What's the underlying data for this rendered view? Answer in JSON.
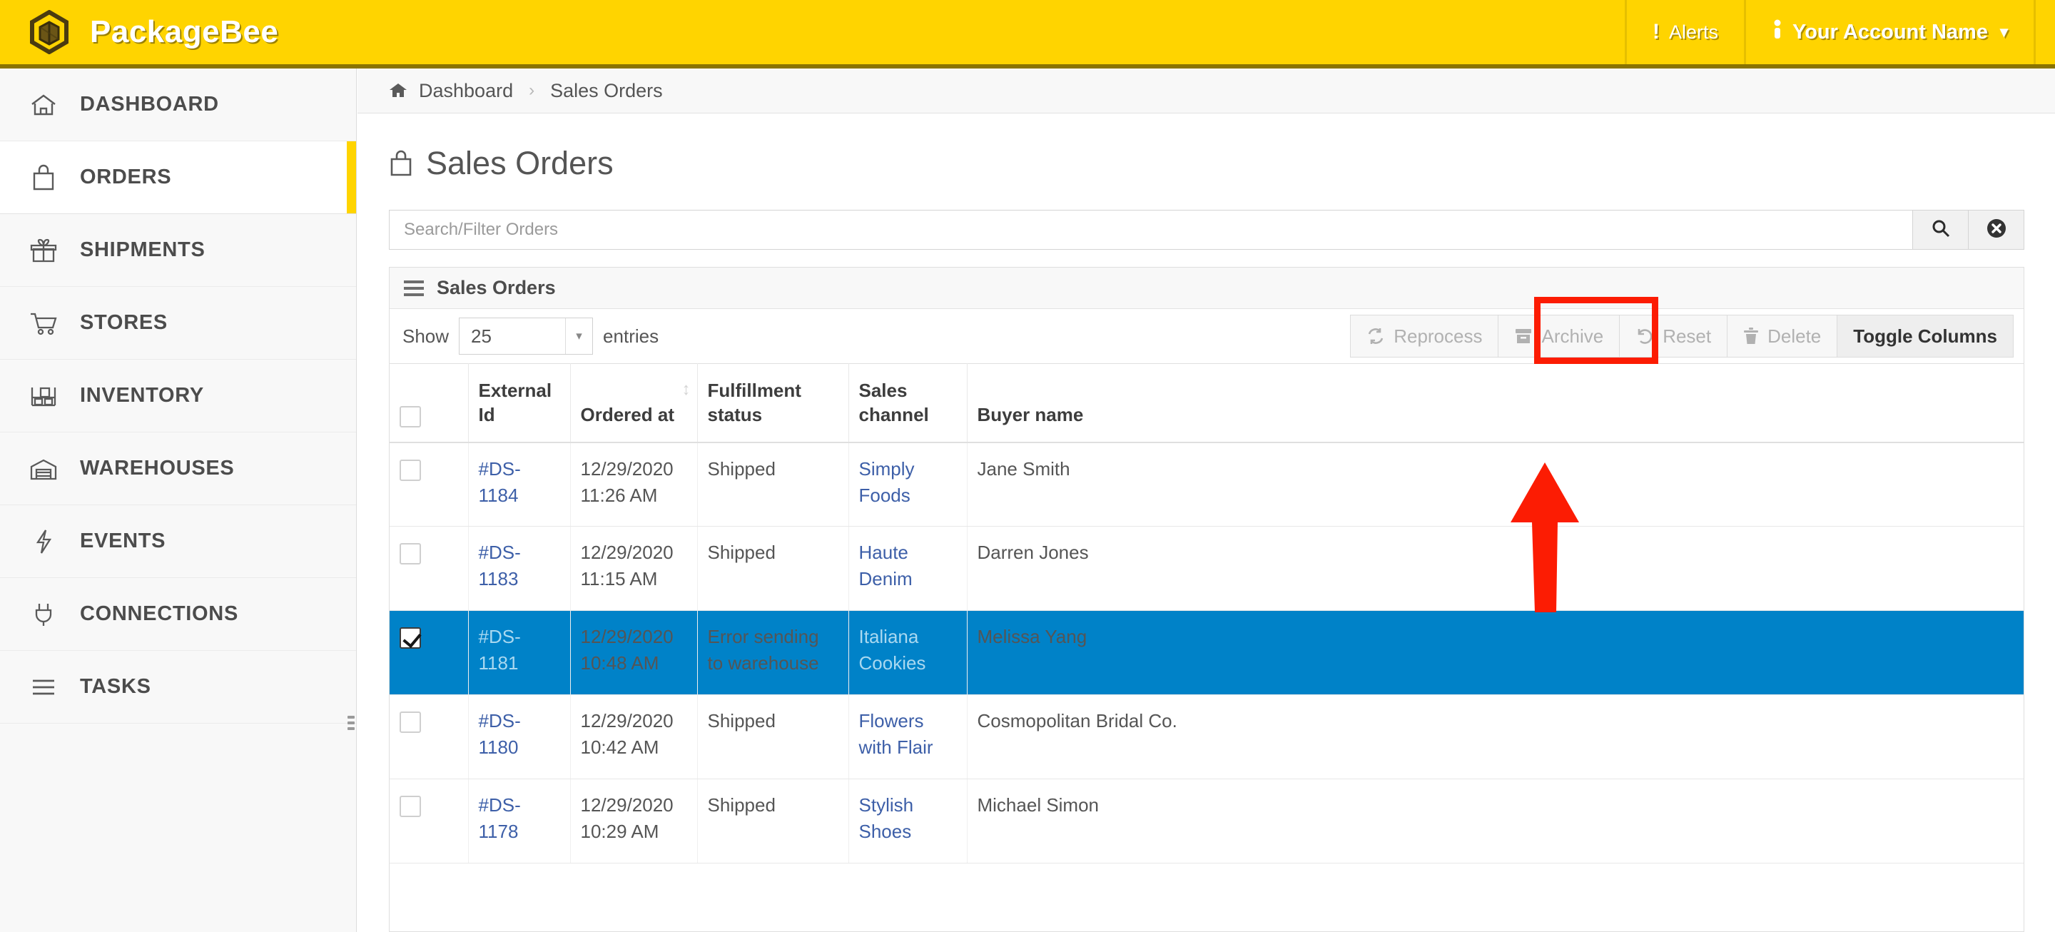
{
  "header": {
    "brand": "PackageBee",
    "brand_logo_icon": "hexagon-box-logo-icon",
    "alerts_label": "Alerts",
    "alerts_icon": "exclamation-icon",
    "account_label": "Your Account Name",
    "account_icon": "person-icon",
    "account_caret_icon": "chevron-down-icon",
    "brand_bg_color": "#ffd400",
    "brand_border_color": "#8a7400"
  },
  "sidebar": {
    "items": [
      {
        "label": "DASHBOARD",
        "icon": "home-icon",
        "active": false
      },
      {
        "label": "ORDERS",
        "icon": "shopping-bag-icon",
        "active": true
      },
      {
        "label": "SHIPMENTS",
        "icon": "gift-box-icon",
        "active": false
      },
      {
        "label": "STORES",
        "icon": "shopping-cart-icon",
        "active": false
      },
      {
        "label": "INVENTORY",
        "icon": "shelf-boxes-icon",
        "active": false
      },
      {
        "label": "WAREHOUSES",
        "icon": "warehouse-icon",
        "active": false
      },
      {
        "label": "EVENTS",
        "icon": "lightning-bolt-icon",
        "active": false
      },
      {
        "label": "CONNECTIONS",
        "icon": "power-plug-icon",
        "active": false
      },
      {
        "label": "TASKS",
        "icon": "list-lines-icon",
        "active": false
      }
    ],
    "active_accent_color": "#ffd400"
  },
  "breadcrumb": {
    "home_icon": "home-icon",
    "parent": "Dashboard",
    "separator": "›",
    "current": "Sales Orders"
  },
  "page": {
    "title": "Sales Orders",
    "title_icon": "shopping-bag-icon"
  },
  "search": {
    "placeholder": "Search/Filter Orders",
    "value": "",
    "search_icon": "search-icon",
    "clear_icon": "clear-circle-x-icon"
  },
  "panel": {
    "title": "Sales Orders",
    "title_icon": "hamburger-icon"
  },
  "toolbar": {
    "show_label": "Show",
    "entries_value": "25",
    "entries_caret_icon": "caret-down-icon",
    "entries_label": "entries",
    "buttons": [
      {
        "label": "Reprocess",
        "icon": "refresh-cycle-icon",
        "style": "muted",
        "highlighted": false
      },
      {
        "label": "Archive",
        "icon": "archive-box-icon",
        "style": "muted",
        "highlighted": true
      },
      {
        "label": "Reset",
        "icon": "undo-arrow-icon",
        "style": "muted",
        "highlighted": false
      },
      {
        "label": "Delete",
        "icon": "trash-can-icon",
        "style": "muted",
        "highlighted": false
      },
      {
        "label": "Toggle Columns",
        "icon": "",
        "style": "strong",
        "highlighted": false
      }
    ]
  },
  "annotation": {
    "highlight_color": "#fc1c03",
    "arrow_icon": "up-arrow-annotation-icon",
    "target": "Archive"
  },
  "table": {
    "select_all_checked": false,
    "columns": [
      {
        "label": "",
        "key": "checkbox",
        "sortable": false
      },
      {
        "label": "External Id",
        "key": "external_id",
        "sortable": false
      },
      {
        "label": "Ordered at",
        "key": "ordered_at",
        "sortable": true,
        "sort_icon": "sort-updown-icon"
      },
      {
        "label": "Fulfillment status",
        "key": "fulfillment",
        "sortable": false
      },
      {
        "label": "Sales channel",
        "key": "channel",
        "sortable": false
      },
      {
        "label": "Buyer name",
        "key": "buyer",
        "sortable": false
      }
    ],
    "rows": [
      {
        "checked": false,
        "selected": false,
        "external_id": "#DS-1184",
        "ordered_date": "12/29/2020",
        "ordered_time": "11:26 AM",
        "fulfillment": "Shipped",
        "channel": "Simply Foods",
        "buyer": "Jane Smith"
      },
      {
        "checked": false,
        "selected": false,
        "external_id": "#DS-1183",
        "ordered_date": "12/29/2020",
        "ordered_time": "11:15 AM",
        "fulfillment": "Shipped",
        "channel": "Haute Denim",
        "buyer": "Darren Jones"
      },
      {
        "checked": true,
        "selected": true,
        "external_id": "#DS-1181",
        "ordered_date": "12/29/2020",
        "ordered_time": "10:48 AM",
        "fulfillment": "Error sending to warehouse",
        "channel": "Italiana Cookies",
        "buyer": "Melissa Yang"
      },
      {
        "checked": false,
        "selected": false,
        "external_id": "#DS-1180",
        "ordered_date": "12/29/2020",
        "ordered_time": "10:42 AM",
        "fulfillment": "Shipped",
        "channel": "Flowers with Flair",
        "buyer": "Cosmopolitan Bridal Co."
      },
      {
        "checked": false,
        "selected": false,
        "external_id": "#DS-1178",
        "ordered_date": "12/29/2020",
        "ordered_time": "10:29 AM",
        "fulfillment": "Shipped",
        "channel": "Stylish Shoes",
        "buyer": "Michael Simon"
      }
    ],
    "selected_row_color": "#0082c8",
    "link_color": "#3d5fa8"
  }
}
